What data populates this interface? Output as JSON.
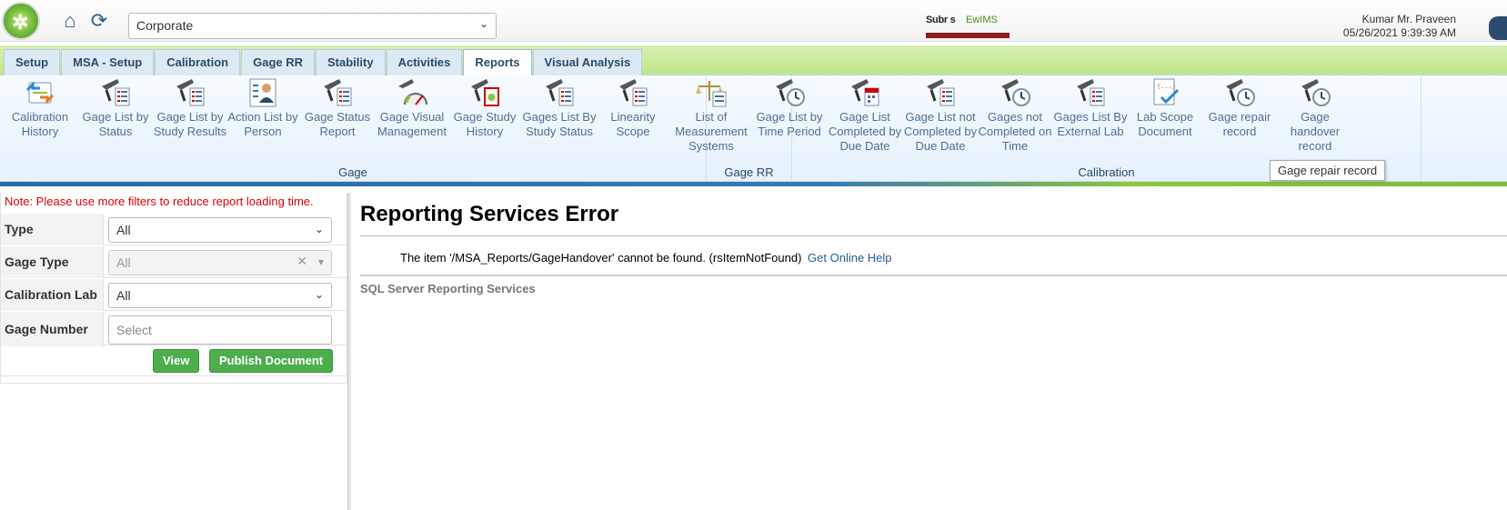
{
  "header": {
    "company": "Corporate",
    "brand_left": "Subr s",
    "brand_right": "EwIMS",
    "user_name": "Kumar Mr. Praveen",
    "datetime": "05/26/2021 9:39:39 AM"
  },
  "tabs": [
    {
      "label": "Setup"
    },
    {
      "label": "MSA - Setup"
    },
    {
      "label": "Calibration"
    },
    {
      "label": "Gage RR"
    },
    {
      "label": "Stability"
    },
    {
      "label": "Activities"
    },
    {
      "label": "Reports",
      "active": true
    },
    {
      "label": "Visual Analysis"
    }
  ],
  "ribbon": {
    "gage_group_label": "Gage",
    "gagerr_group_label": "Gage RR",
    "calibration_group_label": "Calibration",
    "items": [
      {
        "label": "Calibration History",
        "icon": "calibration-history-icon"
      },
      {
        "label": "Gage List by Status",
        "icon": "caliper-list-icon"
      },
      {
        "label": "Gage List by Study Results",
        "icon": "caliper-list-icon"
      },
      {
        "label": "Action List by Person",
        "icon": "person-list-icon"
      },
      {
        "label": "Gage Status Report",
        "icon": "caliper-list-icon"
      },
      {
        "label": "Gage Visual Management",
        "icon": "gauge-meter-icon"
      },
      {
        "label": "Gage Study History",
        "icon": "caliper-history-icon"
      },
      {
        "label": "Gages List By Study Status",
        "icon": "caliper-list-icon"
      },
      {
        "label": "Linearity Scope",
        "icon": "caliper-list-icon"
      },
      {
        "label": "List of Measurement Systems",
        "icon": "scale-list-icon"
      },
      {
        "label": "Gage List by Time Period",
        "icon": "caliper-clock-icon"
      },
      {
        "label": "Gage List Completed by Due Date",
        "icon": "caliper-calendar-icon"
      },
      {
        "label": "Gage List not Completed by Due Date",
        "icon": "caliper-list-icon"
      },
      {
        "label": "Gages not Completed on Time",
        "icon": "caliper-clock-icon"
      },
      {
        "label": "Gages List By External Lab",
        "icon": "caliper-list-icon"
      },
      {
        "label": "Lab Scope Document",
        "icon": "document-check-icon"
      },
      {
        "label": "Gage repair record",
        "icon": "caliper-clock-icon"
      },
      {
        "label": "Gage handover record",
        "icon": "caliper-clock-icon"
      }
    ]
  },
  "tooltip": "Gage repair record",
  "filters": {
    "note": "Note: Please use more filters to reduce report loading time.",
    "type_label": "Type",
    "type_value": "All",
    "gage_type_label": "Gage Type",
    "gage_type_value": "All",
    "calibration_lab_label": "Calibration Lab",
    "calibration_lab_value": "All",
    "gage_number_label": "Gage Number",
    "gage_number_placeholder": "Select",
    "view_button": "View",
    "publish_button": "Publish Document"
  },
  "report": {
    "title": "Reporting Services Error",
    "message": "The item '/MSA_Reports/GageHandover' cannot be found. (rsItemNotFound)",
    "help_link": "Get Online Help",
    "footer": "SQL Server Reporting Services"
  },
  "colors": {
    "tab_green": "#c1e58a",
    "ribbon_blue": "#e6f1fb",
    "button_green": "#4cae4c",
    "note_red": "#dd0000"
  }
}
